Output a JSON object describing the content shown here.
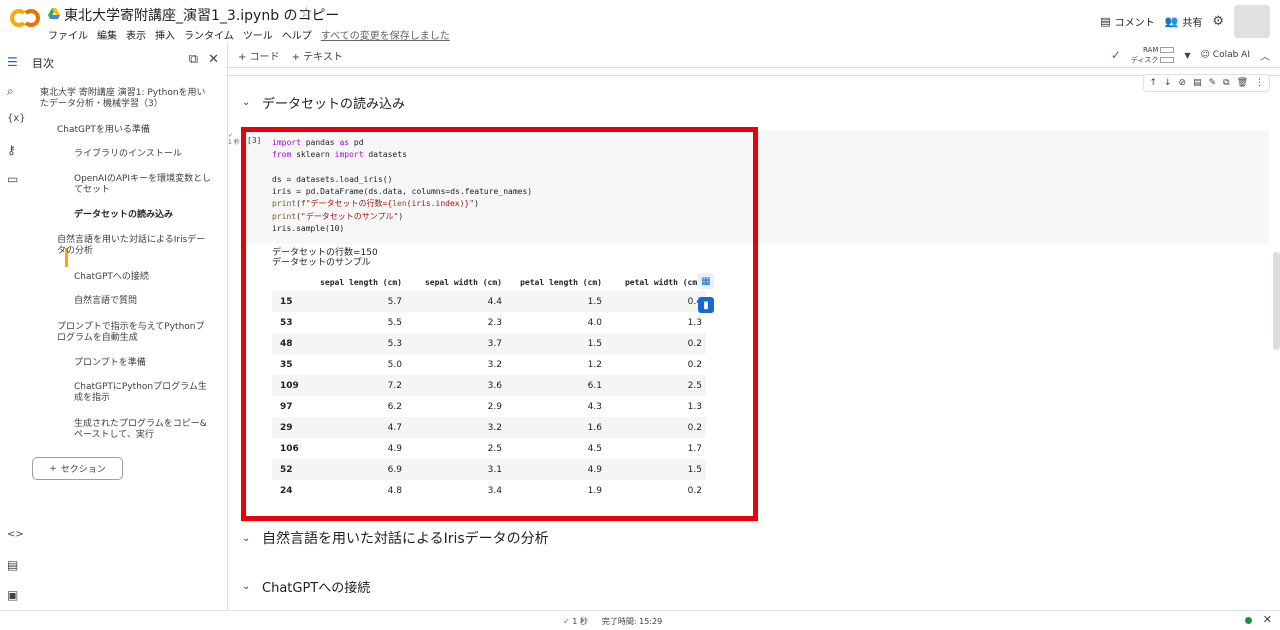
{
  "header": {
    "title": "東北大学寄附講座_演習1_3.ipynb のコピー",
    "menu": [
      "ファイル",
      "編集",
      "表示",
      "挿入",
      "ランタイム",
      "ツール",
      "ヘルプ"
    ],
    "save_status": "すべての変更を保存しました",
    "comment_label": "コメント",
    "share_label": "共有"
  },
  "toc": {
    "heading": "目次",
    "items": [
      "東北大学 寄附講座 演習1: Pythonを用いたデータ分析・機械学習（3）",
      "ChatGPTを用いる準備",
      "ライブラリのインストール",
      "OpenAIのAPIキーを環境変数としてセット",
      "データセットの読み込み",
      "自然言語を用いた対話によるIrisデータの分析",
      "ChatGPTへの接続",
      "自然言語で質問",
      "プロンプトで指示を与えてPythonプログラムを自動生成",
      "プロンプトを準備",
      "ChatGPTにPythonプログラム生成を指示",
      "生成されたプログラムをコピー&ペーストして、実行"
    ],
    "section_button": "セクション"
  },
  "toolbar": {
    "code_label": "コード",
    "text_label": "テキスト",
    "ram_label": "RAM",
    "disk_label": "ディスク",
    "colab_ai_label": "Colab AI"
  },
  "notebook": {
    "section1": "データセットの読み込み",
    "section2": "自然言語を用いた対話によるIrisデータの分析",
    "section3": "ChatGPTへの接続",
    "exec_count": "[3]",
    "run_time_badge": "1 秒",
    "output_line1": "データセットの行数=150",
    "output_line2": "データセットのサンプル",
    "table": {
      "columns": [
        "sepal length (cm)",
        "sepal width (cm)",
        "petal length (cm)",
        "petal width (cm)"
      ],
      "rows": [
        [
          "15",
          "5.7",
          "4.4",
          "1.5",
          "0.4"
        ],
        [
          "53",
          "5.5",
          "2.3",
          "4.0",
          "1.3"
        ],
        [
          "48",
          "5.3",
          "3.7",
          "1.5",
          "0.2"
        ],
        [
          "35",
          "5.0",
          "3.2",
          "1.2",
          "0.2"
        ],
        [
          "109",
          "7.2",
          "3.6",
          "6.1",
          "2.5"
        ],
        [
          "97",
          "6.2",
          "2.9",
          "4.3",
          "1.3"
        ],
        [
          "29",
          "4.7",
          "3.2",
          "1.6",
          "0.2"
        ],
        [
          "106",
          "4.9",
          "2.5",
          "4.5",
          "1.7"
        ],
        [
          "52",
          "6.9",
          "3.1",
          "4.9",
          "1.5"
        ],
        [
          "24",
          "4.8",
          "3.4",
          "1.9",
          "0.2"
        ]
      ]
    }
  },
  "status": {
    "duration": "1 秒",
    "completed": "完了時間: 15:29"
  },
  "colors": {
    "highlight": "#e8000b",
    "accent": "#f9ab00",
    "status_ok": "#1e8e3e"
  },
  "icons": [
    "colab-logo-icon",
    "drive-icon",
    "star-icon",
    "comment-icon",
    "share-icon",
    "gear-icon",
    "toc-icon",
    "search-icon",
    "variables-icon",
    "key-icon",
    "folder-icon",
    "code-icon",
    "terminal-icon",
    "check-icon",
    "chevron-down-icon"
  ]
}
